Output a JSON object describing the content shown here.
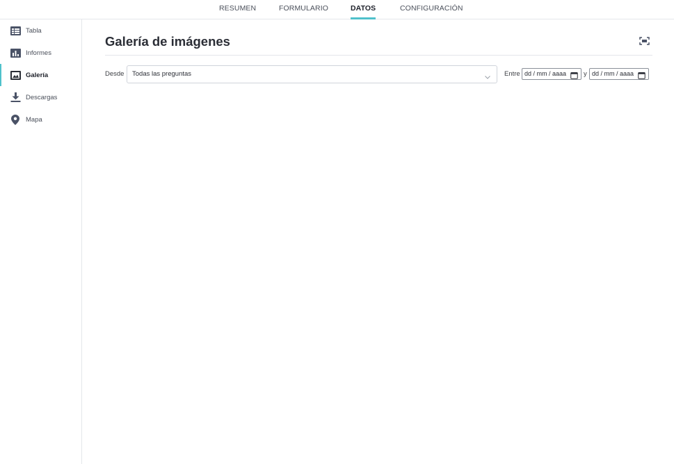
{
  "tabs": [
    {
      "label": "RESUMEN",
      "active": false
    },
    {
      "label": "FORMULARIO",
      "active": false
    },
    {
      "label": "DATOS",
      "active": true
    },
    {
      "label": "CONFIGURACIÓN",
      "active": false
    }
  ],
  "sidebar": {
    "items": [
      {
        "label": "Tabla",
        "icon": "table-icon",
        "active": false
      },
      {
        "label": "Informes",
        "icon": "bar-chart-icon",
        "active": false
      },
      {
        "label": "Galería",
        "icon": "image-icon",
        "active": true
      },
      {
        "label": "Descargas",
        "icon": "download-icon",
        "active": false
      },
      {
        "label": "Mapa",
        "icon": "map-pin-icon",
        "active": false
      }
    ]
  },
  "main": {
    "title": "Galería de imágenes",
    "expand_icon": "fullscreen-icon",
    "filters": {
      "from_label": "Desde",
      "question_select_value": "Todas las preguntas",
      "between_label": "Entre",
      "start_date_placeholder": "dd / mm / aaaa",
      "and_label": "y",
      "end_date_placeholder": "dd / mm / aaaa"
    }
  },
  "colors": {
    "accent": "#4fc1cb",
    "icon": "#4a5266",
    "border": "#e4e6ea"
  }
}
